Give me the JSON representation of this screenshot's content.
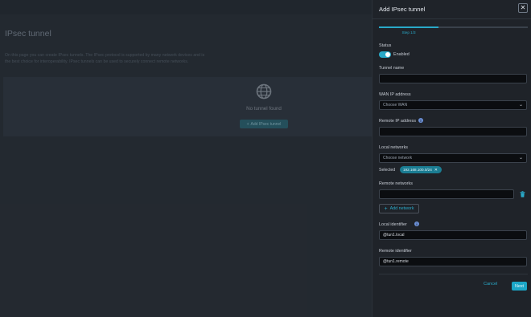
{
  "background": {
    "title": "IPsec tunnel",
    "description": "On this page you can create IPsec tunnels. The IPsec protocol is supported by many network devices and is the best choice for interoperability. IPsec tunnels can be used to securely connect remote networks.",
    "empty_text": "No tunnel found",
    "add_button_label": "Add IPsec tunnel",
    "globe_icon": "globe-icon"
  },
  "drawer": {
    "title": "Add IPsec tunnel",
    "close_icon": "close-icon",
    "step_label": "Step 1/3",
    "progress": 0.4,
    "status": {
      "label": "Status",
      "toggle_label": "Enabled",
      "enabled": true
    },
    "tunnel_name": {
      "label": "Tunnel name",
      "value": ""
    },
    "wan_ip": {
      "label": "WAN IP address",
      "selected": "Choose WAN"
    },
    "remote_ip": {
      "label": "Remote IP address",
      "value": ""
    },
    "local_networks": {
      "label": "Local networks",
      "selected": "Choose network",
      "selected_label": "Selected",
      "chips": [
        "192.168.100.0/24"
      ]
    },
    "remote_networks": {
      "label": "Remote networks",
      "value": "",
      "add_label": "Add network"
    },
    "local_identifier": {
      "label": "Local identifier",
      "value": "@tun1.local"
    },
    "remote_identifier": {
      "label": "Remote identifier",
      "value": "@tun1.remote"
    },
    "cancel_label": "Cancel",
    "next_label": "Next"
  },
  "colors": {
    "accent": "#29a9c8",
    "drawer_bg": "#1f2329",
    "input_bg": "#0b0d10"
  }
}
